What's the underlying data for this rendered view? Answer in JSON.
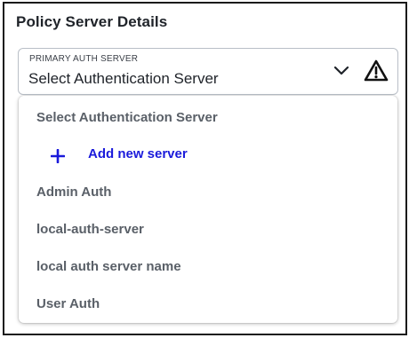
{
  "panel": {
    "title": "Policy Server Details"
  },
  "auth_select": {
    "label": "PRIMARY AUTH SERVER",
    "selected_value": "Select Authentication Server",
    "chevron_icon": "chevron-down-icon",
    "warning_icon": "warning-triangle-icon"
  },
  "dropdown": {
    "placeholder_option": "Select Authentication Server",
    "add_new": {
      "icon": "plus-icon",
      "label": "Add new server",
      "color": "#1a1adb"
    },
    "options": [
      "Admin Auth",
      "local-auth-server",
      "local auth server name",
      "User Auth"
    ]
  }
}
